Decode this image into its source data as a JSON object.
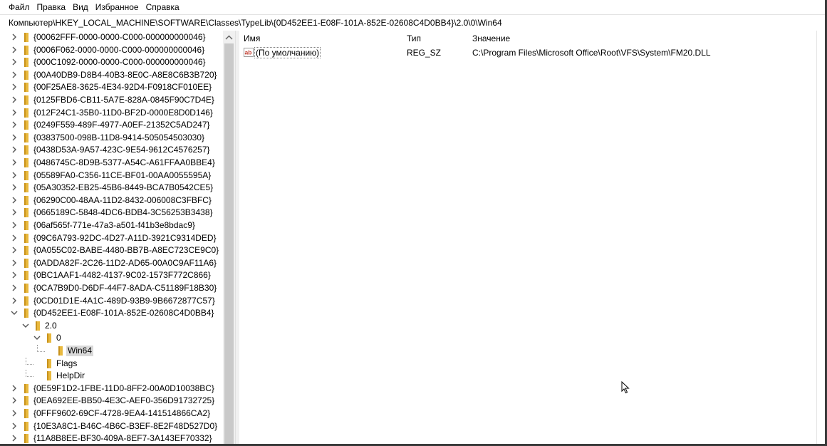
{
  "menu": [
    "Файл",
    "Правка",
    "Вид",
    "Избранное",
    "Справка"
  ],
  "address": "Компьютер\\HKEY_LOCAL_MACHINE\\SOFTWARE\\Classes\\TypeLib\\{0D452EE1-E08F-101A-852E-02608C4D0BB4}\\2.0\\0\\Win64",
  "tree": [
    {
      "label": "{00062FFF-0000-0000-C000-000000000046}",
      "level": 0,
      "expander": "collapsed"
    },
    {
      "label": "{0006F062-0000-0000-C000-000000000046}",
      "level": 0,
      "expander": "collapsed"
    },
    {
      "label": "{000C1092-0000-0000-C000-000000000046}",
      "level": 0,
      "expander": "collapsed"
    },
    {
      "label": "{00A40DB9-D8B4-40B3-8E0C-A8E8C6B3B720}",
      "level": 0,
      "expander": "collapsed"
    },
    {
      "label": "{00F25AE8-3625-4E34-92D4-F0918CF010EE}",
      "level": 0,
      "expander": "collapsed"
    },
    {
      "label": "{0125FBD6-CB11-5A7E-828A-0845F90C7D4E}",
      "level": 0,
      "expander": "collapsed"
    },
    {
      "label": "{012F24C1-35B0-11D0-BF2D-0000E8D0D146}",
      "level": 0,
      "expander": "collapsed"
    },
    {
      "label": "{0249F559-489F-4977-A0EF-21352C5AD247}",
      "level": 0,
      "expander": "collapsed"
    },
    {
      "label": "{03837500-098B-11D8-9414-505054503030}",
      "level": 0,
      "expander": "collapsed"
    },
    {
      "label": "{0438D53A-9A57-423C-9E54-9612C4576257}",
      "level": 0,
      "expander": "collapsed"
    },
    {
      "label": "{0486745C-8D9B-5377-A54C-A61FFAA0BBE4}",
      "level": 0,
      "expander": "collapsed"
    },
    {
      "label": "{05589FA0-C356-11CE-BF01-00AA0055595A}",
      "level": 0,
      "expander": "collapsed"
    },
    {
      "label": "{05A30352-EB25-45B6-8449-BCA7B0542CE5}",
      "level": 0,
      "expander": "collapsed"
    },
    {
      "label": "{06290C00-48AA-11D2-8432-006008C3FBFC}",
      "level": 0,
      "expander": "collapsed"
    },
    {
      "label": "{0665189C-5848-4DC6-BDB4-3C56253B3438}",
      "level": 0,
      "expander": "collapsed"
    },
    {
      "label": "{06af565f-771e-47a3-a501-f41b3e8bdac9}",
      "level": 0,
      "expander": "collapsed"
    },
    {
      "label": "{09C6A793-92DC-4D27-A11D-3921C9314DED}",
      "level": 0,
      "expander": "collapsed"
    },
    {
      "label": "{0A055C02-BABE-4480-BB7B-A8EC723CE9C0}",
      "level": 0,
      "expander": "collapsed"
    },
    {
      "label": "{0ADDA82F-2C26-11D2-AD65-00A0C9AF11A6}",
      "level": 0,
      "expander": "collapsed"
    },
    {
      "label": "{0BC1AAF1-4482-4137-9C02-1573F772C866}",
      "level": 0,
      "expander": "collapsed"
    },
    {
      "label": "{0CA7B9D0-D6DF-44F7-8ADA-C51189F18B30}",
      "level": 0,
      "expander": "collapsed"
    },
    {
      "label": "{0CD01D1E-4A1C-489D-93B9-9B6672877C57}",
      "level": 0,
      "expander": "collapsed"
    },
    {
      "label": "{0D452EE1-E08F-101A-852E-02608C4D0BB4}",
      "level": 0,
      "expander": "expanded"
    },
    {
      "label": "2.0",
      "level": 1,
      "expander": "expanded"
    },
    {
      "label": "0",
      "level": 2,
      "expander": "expanded"
    },
    {
      "label": "Win64",
      "level": 3,
      "expander": "none",
      "selected": true
    },
    {
      "label": "Flags",
      "level": 2,
      "expander": "none"
    },
    {
      "label": "HelpDir",
      "level": 2,
      "expander": "none"
    },
    {
      "label": "{0E59F1D2-1FBE-11D0-8FF2-00A0D10038BC}",
      "level": 0,
      "expander": "collapsed"
    },
    {
      "label": "{0EA692EE-BB50-4E3C-AEF0-356D91732725}",
      "level": 0,
      "expander": "collapsed"
    },
    {
      "label": "{0FFF9602-69CF-4728-9EA4-141514866CA2}",
      "level": 0,
      "expander": "collapsed"
    },
    {
      "label": "{10E3A8C1-B46C-4B6C-B3EF-8E2F48D527D0}",
      "level": 0,
      "expander": "collapsed"
    },
    {
      "label": "{11A8B8EE-BF30-409A-8EF7-3A143EF70332}",
      "level": 0,
      "expander": "collapsed"
    }
  ],
  "columns": {
    "name": "Имя",
    "type": "Тип",
    "value": "Значение"
  },
  "values": [
    {
      "name": "(По умолчанию)",
      "type": "REG_SZ",
      "data": "C:\\Program Files\\Microsoft Office\\Root\\VFS\\System\\FM20.DLL"
    }
  ],
  "colors": {
    "folder": "#e8b83d",
    "selection": "#d9d9d9",
    "chevron": "#555555",
    "ab_icon": "#c0392b"
  }
}
